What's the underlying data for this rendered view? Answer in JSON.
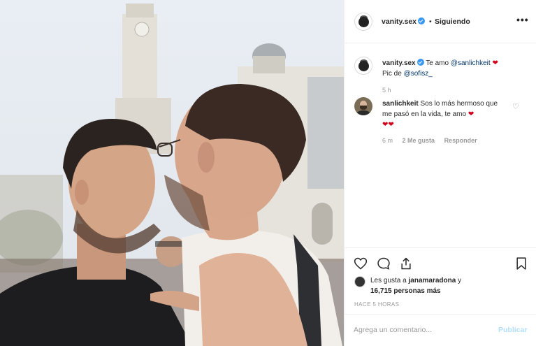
{
  "post": {
    "username": "vanity.sex",
    "follow_status": "Siguiendo",
    "separator": "•",
    "more_label": "•••"
  },
  "caption": {
    "username": "vanity.sex",
    "text_1": "Te amo",
    "mention_1": "@sanlichkeit",
    "heart": "❤",
    "text_2": "Pic de",
    "mention_2": "@sofisz_",
    "time": "5 h"
  },
  "comment": {
    "username": "sanlichkeit",
    "text": "Sos lo más hermoso que me pasó en la vida, te amo",
    "hearts": "❤❤",
    "time": "6 m",
    "likes": "2 Me gusta",
    "reply": "Responder",
    "like_icon": "♡"
  },
  "likes": {
    "prefix": "Les gusta a",
    "user": "janamaradona",
    "middle": "y",
    "count": "16,715 personas más"
  },
  "time_ago": "HACE 5 HORAS",
  "add_comment": {
    "placeholder": "Agrega un comentario...",
    "publish": "Publicar"
  },
  "icons": {
    "like": "heart-icon",
    "comment": "comment-icon",
    "share": "share-icon",
    "save": "bookmark-icon"
  },
  "colors": {
    "verified": "#3897f0",
    "heart": "#d0021b",
    "publish": "#b2dffc"
  }
}
